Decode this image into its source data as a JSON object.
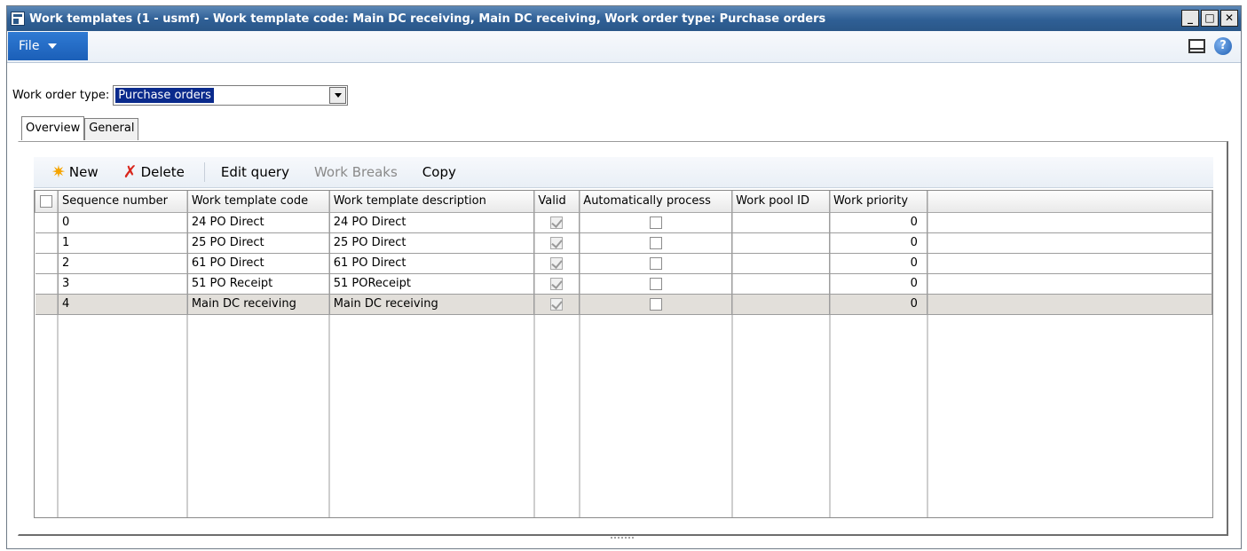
{
  "window": {
    "title": "Work templates (1 - usmf) - Work template code: Main DC receiving, Main DC receiving, Work order type: Purchase orders",
    "controls": {
      "minimize": "_",
      "maximize": "□",
      "close": "✕"
    }
  },
  "ribbon": {
    "file_label": "File",
    "help_label": "?"
  },
  "filter": {
    "label": "Work order type:",
    "value": "Purchase orders"
  },
  "tabs": [
    {
      "label": "Overview",
      "active": true
    },
    {
      "label": "General",
      "active": false
    }
  ],
  "actions": {
    "new_label": "New",
    "delete_label": "Delete",
    "edit_query_label": "Edit query",
    "work_breaks_label": "Work Breaks",
    "copy_label": "Copy"
  },
  "grid": {
    "columns": [
      "Sequence number",
      "Work template code",
      "Work template description",
      "Valid",
      "Automatically process",
      "Work pool ID",
      "Work priority"
    ],
    "rows": [
      {
        "seq": "0",
        "code": "24 PO Direct",
        "desc": "24 PO Direct",
        "valid": true,
        "auto": false,
        "pool": "",
        "priority": "0"
      },
      {
        "seq": "1",
        "code": "25 PO Direct",
        "desc": "25 PO Direct",
        "valid": true,
        "auto": false,
        "pool": "",
        "priority": "0"
      },
      {
        "seq": "2",
        "code": "61 PO Direct",
        "desc": "61 PO Direct",
        "valid": true,
        "auto": false,
        "pool": "",
        "priority": "0"
      },
      {
        "seq": "3",
        "code": "51 PO Receipt",
        "desc": "51 POReceipt",
        "valid": true,
        "auto": false,
        "pool": "",
        "priority": "0"
      },
      {
        "seq": "4",
        "code": "Main DC receiving",
        "desc": "Main DC receiving",
        "valid": true,
        "auto": false,
        "pool": "",
        "priority": "0"
      }
    ],
    "selected_row": 4
  },
  "icons": {
    "app": "app-window-icon",
    "new": "sun-star-icon",
    "delete": "red-x-icon",
    "layout": "layout-panel-icon",
    "help": "help-circle-icon"
  },
  "colors": {
    "titlebar": "#2f5f95",
    "file_button": "#1b5fb8",
    "selection": "#0a2a8c",
    "selected_row": "#e2dfda"
  }
}
